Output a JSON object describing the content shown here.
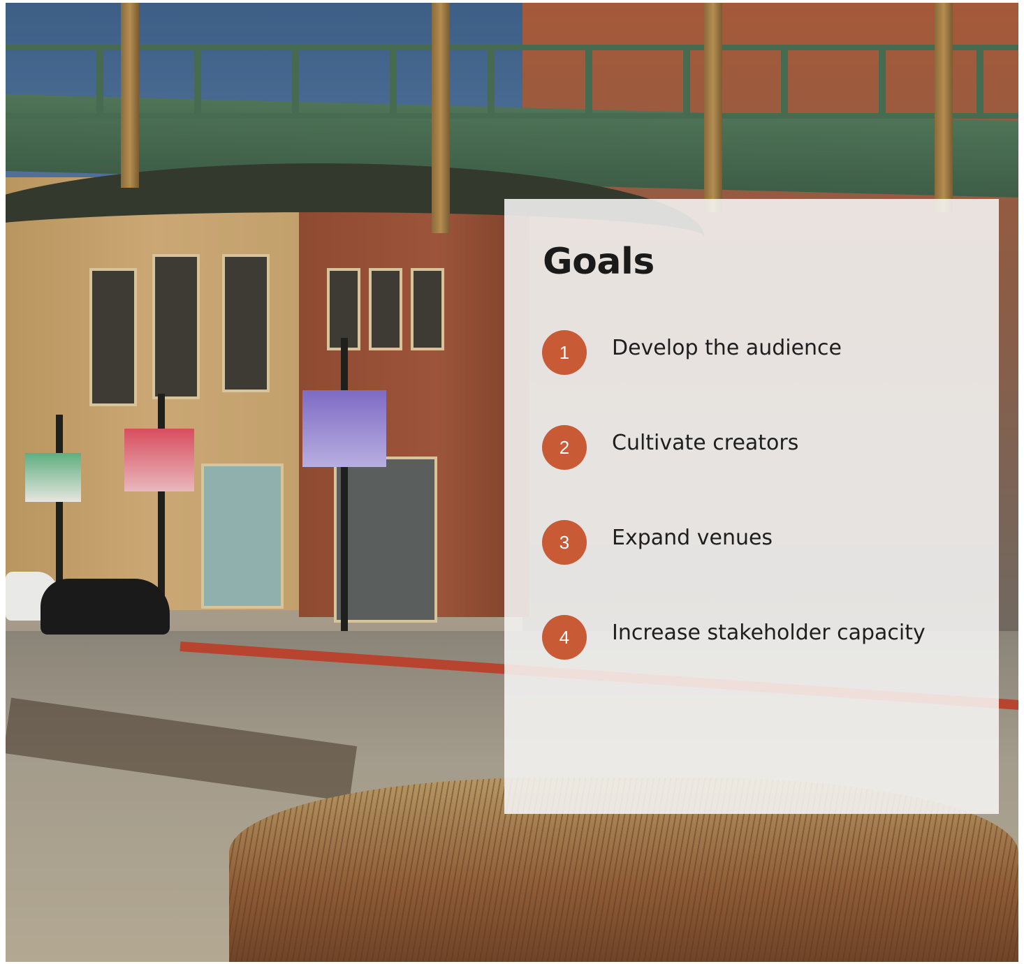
{
  "panel": {
    "title": "Goals",
    "accent_color": "#c85a35",
    "goals": [
      {
        "number": "1",
        "label": "Develop the audience"
      },
      {
        "number": "2",
        "label": "Cultivate creators"
      },
      {
        "number": "3",
        "label": "Expand venues"
      },
      {
        "number": "4",
        "label": "Increase stakeholder capacity"
      }
    ]
  }
}
